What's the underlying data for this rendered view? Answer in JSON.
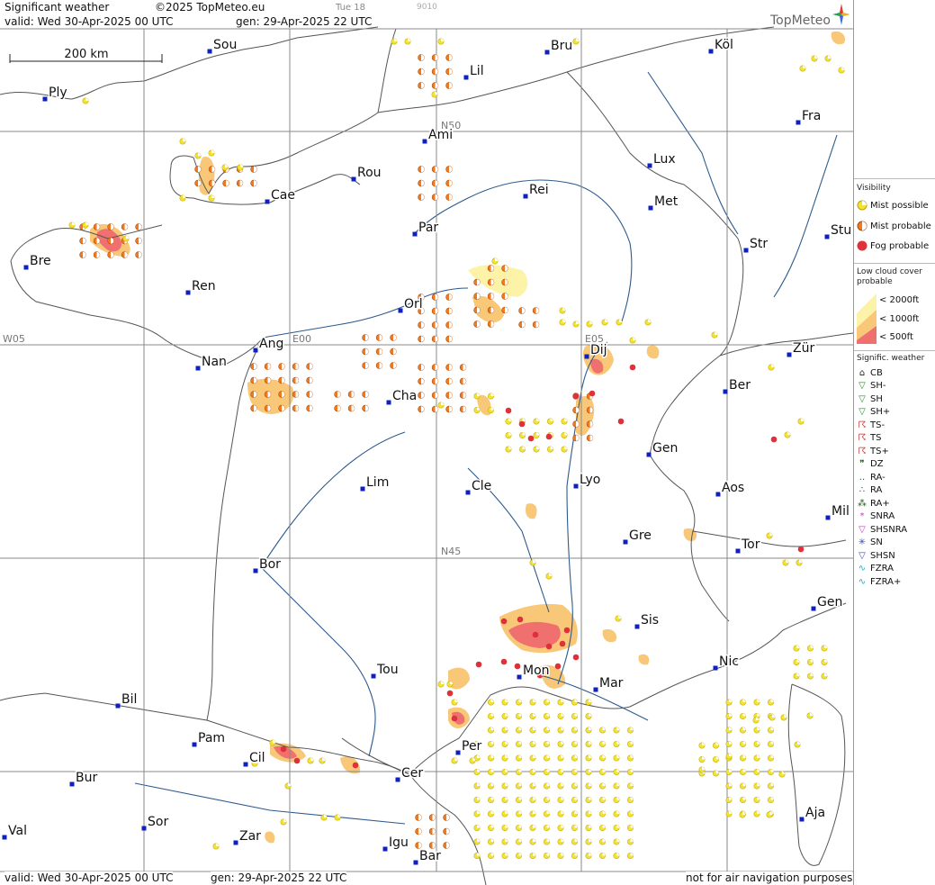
{
  "header": {
    "product": "Significant weather",
    "copyright": "©2025 TopMeteo.eu",
    "valid_top": "valid:  Wed  30-Apr-2025  00 UTC",
    "gen_top": "gen: 29-Apr-2025 22 UTC",
    "tue": "Tue 18",
    "code": "9010",
    "valid_bottom": "valid:  Wed  30-Apr-2025  00 UTC",
    "gen_bottom": "gen: 29-Apr-2025 22 UTC",
    "disclaimer": "not for air navigation purposes",
    "brand": "TopMeteo"
  },
  "scale": {
    "label": "200 km"
  },
  "grid_labels": [
    "N50",
    "N45",
    "W05",
    "E00",
    "E05"
  ],
  "cities": [
    {
      "name": "Sou"
    },
    {
      "name": "Bru"
    },
    {
      "name": "Köl"
    },
    {
      "name": "Ply"
    },
    {
      "name": "Lil"
    },
    {
      "name": "Ami"
    },
    {
      "name": "Fra"
    },
    {
      "name": "Rou"
    },
    {
      "name": "Lux"
    },
    {
      "name": "Cae"
    },
    {
      "name": "Rei"
    },
    {
      "name": "Met"
    },
    {
      "name": "Par"
    },
    {
      "name": "Bre"
    },
    {
      "name": "Str"
    },
    {
      "name": "Stu"
    },
    {
      "name": "Ren"
    },
    {
      "name": "Orl"
    },
    {
      "name": "Ang"
    },
    {
      "name": "Dij"
    },
    {
      "name": "Zür"
    },
    {
      "name": "Nan"
    },
    {
      "name": "Ber"
    },
    {
      "name": "Cha"
    },
    {
      "name": "Gen"
    },
    {
      "name": "Lim"
    },
    {
      "name": "Cle"
    },
    {
      "name": "Lyo"
    },
    {
      "name": "Aos"
    },
    {
      "name": "Mil"
    },
    {
      "name": "Gre"
    },
    {
      "name": "Tor"
    },
    {
      "name": "Bor"
    },
    {
      "name": "Gen"
    },
    {
      "name": "Sis"
    },
    {
      "name": "Nic"
    },
    {
      "name": "Tou"
    },
    {
      "name": "Mon"
    },
    {
      "name": "Mar"
    },
    {
      "name": "Bil"
    },
    {
      "name": "Pam"
    },
    {
      "name": "Per"
    },
    {
      "name": "Cil"
    },
    {
      "name": "Bur"
    },
    {
      "name": "Cer"
    },
    {
      "name": "Sor"
    },
    {
      "name": "Val"
    },
    {
      "name": "Zar"
    },
    {
      "name": "Igu"
    },
    {
      "name": "Aja"
    },
    {
      "name": "Bar"
    }
  ],
  "legend": {
    "visibility_title": "Visibility",
    "mist_possible": "Mist possible",
    "mist_probable": "Mist probable",
    "fog_probable": "Fog probable",
    "lowcloud_title_1": "Low cloud cover",
    "lowcloud_title_2": "probable",
    "lc_2000": "< 2000ft",
    "lc_1000": "< 1000ft",
    "lc_500": "<   500ft",
    "sigwx_title": "Signific. weather",
    "items": [
      "CB",
      "SH-",
      "SH",
      "SH+",
      "TS-",
      "TS",
      "TS+",
      "DZ",
      "RA-",
      "RA",
      "RA+",
      "SNRA",
      "SHSNRA",
      "SN",
      "SHSN",
      "FZRA",
      "FZRA+"
    ]
  },
  "colors": {
    "mist_possible": "#f2e23a",
    "mist_probable": "#ee7a22",
    "fog": "#e0303a",
    "lc_2000": "#fdf3a8",
    "lc_1000": "#f8c878",
    "lc_500": "#f07070",
    "river": "#2d5a8c",
    "border": "#555555",
    "grid": "#888888",
    "city": "#1020c0"
  }
}
